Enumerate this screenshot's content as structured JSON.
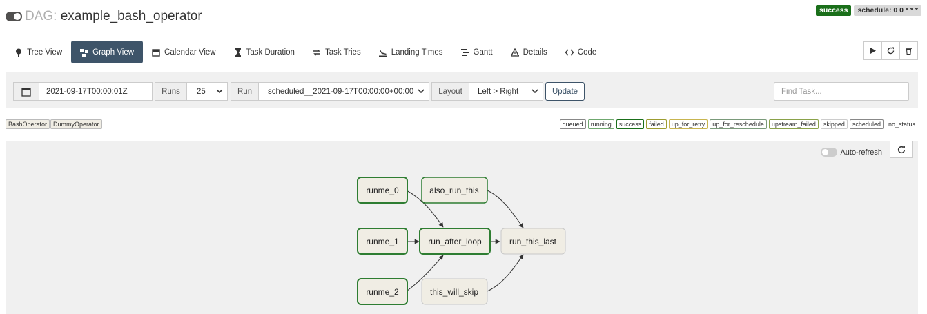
{
  "header": {
    "prefix": "DAG:",
    "dag_id": "example_bash_operator",
    "status": "success",
    "schedule": "schedule: 0 0 * * *"
  },
  "nav": {
    "tree_view": "Tree View",
    "graph_view": "Graph View",
    "calendar_view": "Calendar View",
    "task_duration": "Task Duration",
    "task_tries": "Task Tries",
    "landing_times": "Landing Times",
    "gantt": "Gantt",
    "details": "Details",
    "code": "Code"
  },
  "controls": {
    "base_date": "2021-09-17T00:00:01Z",
    "runs_label": "Runs",
    "runs_value": "25",
    "run_label": "Run",
    "run_value": "scheduled__2021-09-17T00:00:00+00:00",
    "layout_label": "Layout",
    "layout_value": "Left > Right",
    "update": "Update",
    "find_placeholder": "Find Task..."
  },
  "operators": [
    "BashOperator",
    "DummyOperator"
  ],
  "states": [
    "queued",
    "running",
    "success",
    "failed",
    "up_for_retry",
    "up_for_reschedule",
    "upstream_failed",
    "skipped",
    "scheduled",
    "no_status"
  ],
  "graph": {
    "auto_refresh": "Auto-refresh",
    "nodes": {
      "runme_0": "runme_0",
      "runme_1": "runme_1",
      "runme_2": "runme_2",
      "also_run_this": "also_run_this",
      "run_after_loop": "run_after_loop",
      "this_will_skip": "this_will_skip",
      "run_this_last": "run_this_last"
    }
  },
  "colors": {
    "nav_active": "#3e5469",
    "success": "#1a6f1a",
    "node_fill": "#f0ede4",
    "node_success_border": "#2e7d32"
  },
  "icons": {
    "toggle": "dag-pause-toggle",
    "tree": "tree-icon",
    "graph": "graph-icon",
    "calendar": "calendar-icon",
    "duration": "hourglass-icon",
    "tries": "retry-arrows-icon",
    "landing": "landing-plane-icon",
    "gantt": "gantt-bars-icon",
    "details": "warning-triangle-icon",
    "code": "code-icon",
    "trigger": "play-icon",
    "refresh": "refresh-icon",
    "delete": "trash-icon"
  }
}
